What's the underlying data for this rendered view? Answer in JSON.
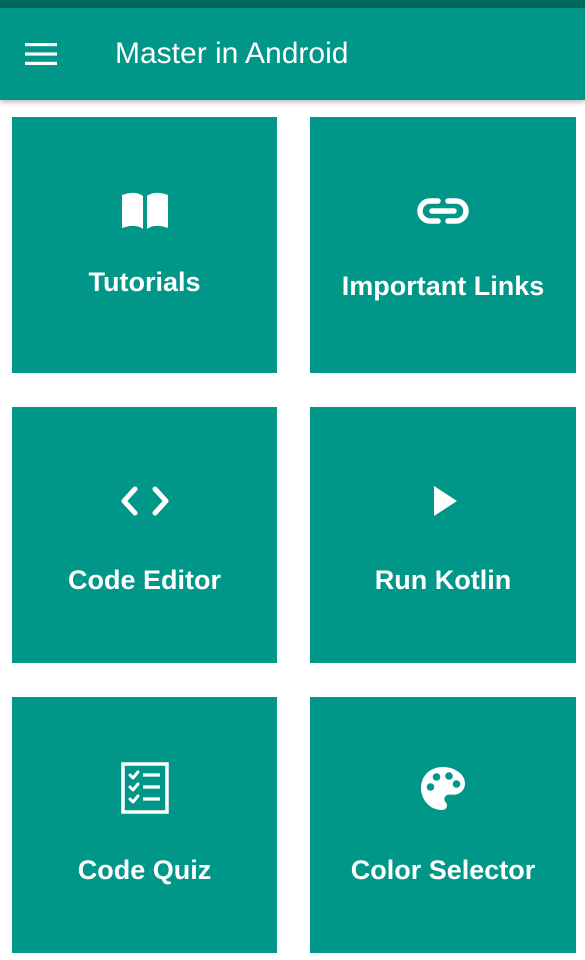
{
  "app_bar": {
    "title": "Master in Android",
    "menu_icon": "hamburger-menu-icon"
  },
  "colors": {
    "primary": "#009688",
    "primary_dark": "#00695c",
    "on_primary": "#ffffff"
  },
  "tiles": [
    {
      "label": "Tutorials",
      "icon": "book-icon"
    },
    {
      "label": "Important Links",
      "icon": "link-icon"
    },
    {
      "label": "Code Editor",
      "icon": "code-icon"
    },
    {
      "label": "Run Kotlin",
      "icon": "play-icon"
    },
    {
      "label": "Code Quiz",
      "icon": "checklist-icon"
    },
    {
      "label": "Color Selector",
      "icon": "palette-icon"
    }
  ]
}
